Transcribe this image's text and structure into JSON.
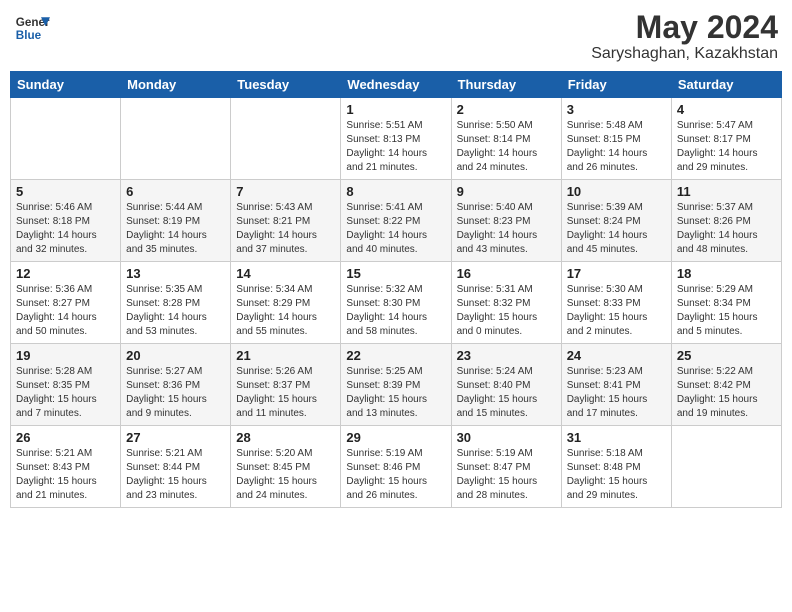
{
  "header": {
    "logo_general": "General",
    "logo_blue": "Blue",
    "month": "May 2024",
    "location": "Saryshaghan, Kazakhstan"
  },
  "weekdays": [
    "Sunday",
    "Monday",
    "Tuesday",
    "Wednesday",
    "Thursday",
    "Friday",
    "Saturday"
  ],
  "weeks": [
    [
      {
        "day": "",
        "sunrise": "",
        "sunset": "",
        "daylight": ""
      },
      {
        "day": "",
        "sunrise": "",
        "sunset": "",
        "daylight": ""
      },
      {
        "day": "",
        "sunrise": "",
        "sunset": "",
        "daylight": ""
      },
      {
        "day": "1",
        "sunrise": "Sunrise: 5:51 AM",
        "sunset": "Sunset: 8:13 PM",
        "daylight": "Daylight: 14 hours and 21 minutes."
      },
      {
        "day": "2",
        "sunrise": "Sunrise: 5:50 AM",
        "sunset": "Sunset: 8:14 PM",
        "daylight": "Daylight: 14 hours and 24 minutes."
      },
      {
        "day": "3",
        "sunrise": "Sunrise: 5:48 AM",
        "sunset": "Sunset: 8:15 PM",
        "daylight": "Daylight: 14 hours and 26 minutes."
      },
      {
        "day": "4",
        "sunrise": "Sunrise: 5:47 AM",
        "sunset": "Sunset: 8:17 PM",
        "daylight": "Daylight: 14 hours and 29 minutes."
      }
    ],
    [
      {
        "day": "5",
        "sunrise": "Sunrise: 5:46 AM",
        "sunset": "Sunset: 8:18 PM",
        "daylight": "Daylight: 14 hours and 32 minutes."
      },
      {
        "day": "6",
        "sunrise": "Sunrise: 5:44 AM",
        "sunset": "Sunset: 8:19 PM",
        "daylight": "Daylight: 14 hours and 35 minutes."
      },
      {
        "day": "7",
        "sunrise": "Sunrise: 5:43 AM",
        "sunset": "Sunset: 8:21 PM",
        "daylight": "Daylight: 14 hours and 37 minutes."
      },
      {
        "day": "8",
        "sunrise": "Sunrise: 5:41 AM",
        "sunset": "Sunset: 8:22 PM",
        "daylight": "Daylight: 14 hours and 40 minutes."
      },
      {
        "day": "9",
        "sunrise": "Sunrise: 5:40 AM",
        "sunset": "Sunset: 8:23 PM",
        "daylight": "Daylight: 14 hours and 43 minutes."
      },
      {
        "day": "10",
        "sunrise": "Sunrise: 5:39 AM",
        "sunset": "Sunset: 8:24 PM",
        "daylight": "Daylight: 14 hours and 45 minutes."
      },
      {
        "day": "11",
        "sunrise": "Sunrise: 5:37 AM",
        "sunset": "Sunset: 8:26 PM",
        "daylight": "Daylight: 14 hours and 48 minutes."
      }
    ],
    [
      {
        "day": "12",
        "sunrise": "Sunrise: 5:36 AM",
        "sunset": "Sunset: 8:27 PM",
        "daylight": "Daylight: 14 hours and 50 minutes."
      },
      {
        "day": "13",
        "sunrise": "Sunrise: 5:35 AM",
        "sunset": "Sunset: 8:28 PM",
        "daylight": "Daylight: 14 hours and 53 minutes."
      },
      {
        "day": "14",
        "sunrise": "Sunrise: 5:34 AM",
        "sunset": "Sunset: 8:29 PM",
        "daylight": "Daylight: 14 hours and 55 minutes."
      },
      {
        "day": "15",
        "sunrise": "Sunrise: 5:32 AM",
        "sunset": "Sunset: 8:30 PM",
        "daylight": "Daylight: 14 hours and 58 minutes."
      },
      {
        "day": "16",
        "sunrise": "Sunrise: 5:31 AM",
        "sunset": "Sunset: 8:32 PM",
        "daylight": "Daylight: 15 hours and 0 minutes."
      },
      {
        "day": "17",
        "sunrise": "Sunrise: 5:30 AM",
        "sunset": "Sunset: 8:33 PM",
        "daylight": "Daylight: 15 hours and 2 minutes."
      },
      {
        "day": "18",
        "sunrise": "Sunrise: 5:29 AM",
        "sunset": "Sunset: 8:34 PM",
        "daylight": "Daylight: 15 hours and 5 minutes."
      }
    ],
    [
      {
        "day": "19",
        "sunrise": "Sunrise: 5:28 AM",
        "sunset": "Sunset: 8:35 PM",
        "daylight": "Daylight: 15 hours and 7 minutes."
      },
      {
        "day": "20",
        "sunrise": "Sunrise: 5:27 AM",
        "sunset": "Sunset: 8:36 PM",
        "daylight": "Daylight: 15 hours and 9 minutes."
      },
      {
        "day": "21",
        "sunrise": "Sunrise: 5:26 AM",
        "sunset": "Sunset: 8:37 PM",
        "daylight": "Daylight: 15 hours and 11 minutes."
      },
      {
        "day": "22",
        "sunrise": "Sunrise: 5:25 AM",
        "sunset": "Sunset: 8:39 PM",
        "daylight": "Daylight: 15 hours and 13 minutes."
      },
      {
        "day": "23",
        "sunrise": "Sunrise: 5:24 AM",
        "sunset": "Sunset: 8:40 PM",
        "daylight": "Daylight: 15 hours and 15 minutes."
      },
      {
        "day": "24",
        "sunrise": "Sunrise: 5:23 AM",
        "sunset": "Sunset: 8:41 PM",
        "daylight": "Daylight: 15 hours and 17 minutes."
      },
      {
        "day": "25",
        "sunrise": "Sunrise: 5:22 AM",
        "sunset": "Sunset: 8:42 PM",
        "daylight": "Daylight: 15 hours and 19 minutes."
      }
    ],
    [
      {
        "day": "26",
        "sunrise": "Sunrise: 5:21 AM",
        "sunset": "Sunset: 8:43 PM",
        "daylight": "Daylight: 15 hours and 21 minutes."
      },
      {
        "day": "27",
        "sunrise": "Sunrise: 5:21 AM",
        "sunset": "Sunset: 8:44 PM",
        "daylight": "Daylight: 15 hours and 23 minutes."
      },
      {
        "day": "28",
        "sunrise": "Sunrise: 5:20 AM",
        "sunset": "Sunset: 8:45 PM",
        "daylight": "Daylight: 15 hours and 24 minutes."
      },
      {
        "day": "29",
        "sunrise": "Sunrise: 5:19 AM",
        "sunset": "Sunset: 8:46 PM",
        "daylight": "Daylight: 15 hours and 26 minutes."
      },
      {
        "day": "30",
        "sunrise": "Sunrise: 5:19 AM",
        "sunset": "Sunset: 8:47 PM",
        "daylight": "Daylight: 15 hours and 28 minutes."
      },
      {
        "day": "31",
        "sunrise": "Sunrise: 5:18 AM",
        "sunset": "Sunset: 8:48 PM",
        "daylight": "Daylight: 15 hours and 29 minutes."
      },
      {
        "day": "",
        "sunrise": "",
        "sunset": "",
        "daylight": ""
      }
    ]
  ]
}
